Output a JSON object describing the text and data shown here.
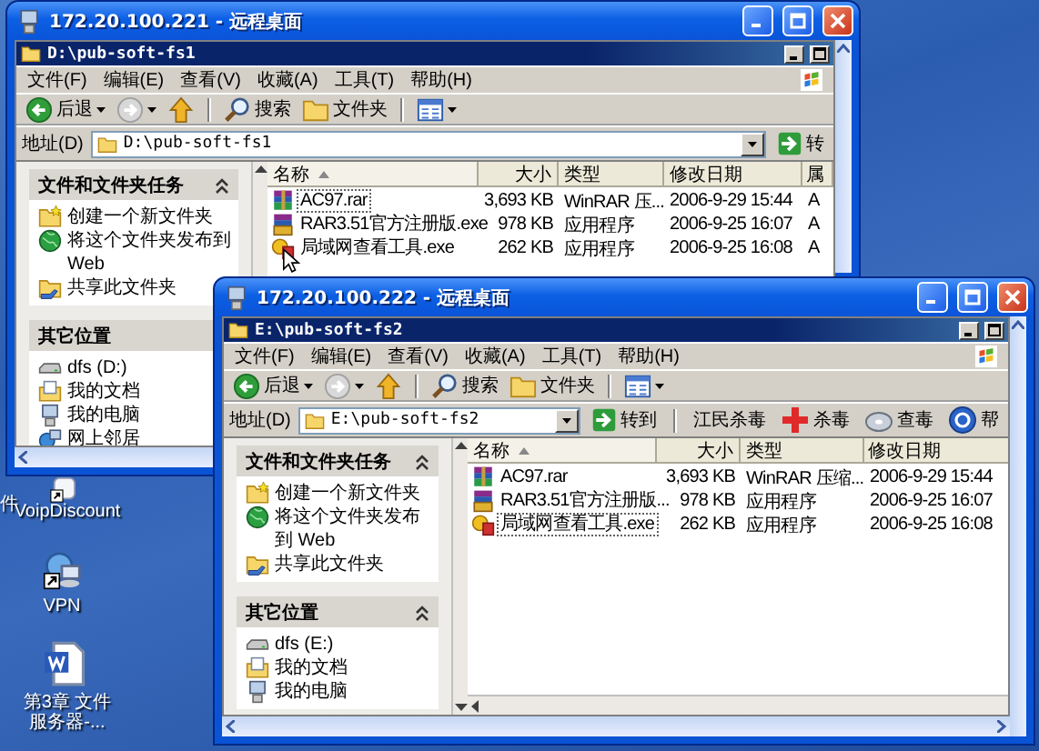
{
  "desktop_icons": [
    {
      "label": "件",
      "kind": "cut"
    },
    {
      "label": "VoipDiscount",
      "kind": "shortcut"
    },
    {
      "label": "VPN",
      "kind": "network-shortcut"
    },
    {
      "label": "第3章 文件服务器-...",
      "kind": "document"
    }
  ],
  "windows": [
    {
      "title": "172.20.100.221 - 远程桌面",
      "explorer": {
        "title": "D:\\pub-soft-fs1",
        "menu": [
          "文件(F)",
          "编辑(E)",
          "查看(V)",
          "收藏(A)",
          "工具(T)",
          "帮助(H)"
        ],
        "toolbar": [
          {
            "kind": "back",
            "label": "后退"
          },
          {
            "kind": "forward"
          },
          {
            "kind": "up"
          },
          {
            "kind": "search",
            "label": "搜索"
          },
          {
            "kind": "folders",
            "label": "文件夹"
          },
          {
            "kind": "views"
          }
        ],
        "address": {
          "label": "地址(D)",
          "value": "D:\\pub-soft-fs1",
          "go": "转"
        },
        "panels": [
          {
            "title": "文件和文件夹任务",
            "expanded": true,
            "items": [
              {
                "label": "创建一个新文件夹",
                "kind": "new-folder"
              },
              {
                "label": "将这个文件夹发布到 Web",
                "kind": "publish"
              },
              {
                "label": "共享此文件夹",
                "kind": "share"
              }
            ]
          },
          {
            "title": "其它位置",
            "items": [
              {
                "label": "dfs (D:)",
                "kind": "drive"
              },
              {
                "label": "我的文档",
                "kind": "documents"
              },
              {
                "label": "我的电脑",
                "kind": "computer"
              },
              {
                "label": "网上邻居",
                "kind": "network"
              }
            ]
          }
        ],
        "columns": [
          {
            "label": "名称",
            "sorted": true
          },
          {
            "label": "大小",
            "sorted": false
          },
          {
            "label": "类型",
            "sorted": false
          },
          {
            "label": "修改日期",
            "sorted": false
          },
          {
            "label": "属",
            "sorted": false
          }
        ],
        "rows": [
          {
            "kind": "archive",
            "focused": true,
            "cells": [
              "AC97.rar",
              "3,693 KB",
              "WinRAR 压...",
              "2006-9-29 15:44",
              "A"
            ]
          },
          {
            "kind": "installer",
            "focused": false,
            "cells": [
              "RAR3.51官方注册版.exe",
              "978 KB",
              "应用程序",
              "2006-9-25 16:07",
              "A"
            ]
          },
          {
            "kind": "app",
            "focused": false,
            "cells": [
              "局域网查看工具.exe",
              "262 KB",
              "应用程序",
              "2006-9-25 16:08",
              "A"
            ]
          }
        ]
      }
    },
    {
      "title": "172.20.100.222 - 远程桌面",
      "explorer": {
        "title": "E:\\pub-soft-fs2",
        "menu": [
          "文件(F)",
          "编辑(E)",
          "查看(V)",
          "收藏(A)",
          "工具(T)",
          "帮助(H)"
        ],
        "toolbar": [
          {
            "kind": "back",
            "label": "后退"
          },
          {
            "kind": "forward"
          },
          {
            "kind": "up"
          },
          {
            "kind": "search",
            "label": "搜索"
          },
          {
            "kind": "folders",
            "label": "文件夹"
          },
          {
            "kind": "views"
          }
        ],
        "address": {
          "label": "地址(D)",
          "value": "E:\\pub-soft-fs2",
          "go": "转到"
        },
        "links": [
          {
            "label": "江民杀毒",
            "kind": "text"
          },
          {
            "label": "杀毒",
            "kind": "kill"
          },
          {
            "label": "查毒",
            "kind": "scan"
          },
          {
            "label": "帮",
            "kind": "help"
          }
        ],
        "panels": [
          {
            "title": "文件和文件夹任务",
            "expanded": true,
            "items": [
              {
                "label": "创建一个新文件夹",
                "kind": "new-folder"
              },
              {
                "label": "将这个文件夹发布到 Web",
                "kind": "publish"
              },
              {
                "label": "共享此文件夹",
                "kind": "share"
              }
            ]
          },
          {
            "title": "其它位置",
            "expanded": true,
            "items": [
              {
                "label": "dfs (E:)",
                "kind": "drive"
              },
              {
                "label": "我的文档",
                "kind": "documents"
              },
              {
                "label": "我的电脑",
                "kind": "computer"
              }
            ]
          }
        ],
        "columns": [
          {
            "label": "名称",
            "sorted": true
          },
          {
            "label": "大小",
            "sorted": false
          },
          {
            "label": "类型",
            "sorted": false
          },
          {
            "label": "修改日期",
            "sorted": false
          }
        ],
        "rows": [
          {
            "kind": "archive",
            "focused": false,
            "cells": [
              "AC97.rar",
              "3,693 KB",
              "WinRAR 压缩...",
              "2006-9-29 15:44"
            ]
          },
          {
            "kind": "installer",
            "focused": false,
            "cells": [
              "RAR3.51官方注册版...",
              "978 KB",
              "应用程序",
              "2006-9-25 16:07"
            ]
          },
          {
            "kind": "app",
            "focused": true,
            "cells": [
              "局域网查看工具.exe",
              "262 KB",
              "应用程序",
              "2006-9-25 16:08"
            ]
          }
        ]
      }
    }
  ]
}
